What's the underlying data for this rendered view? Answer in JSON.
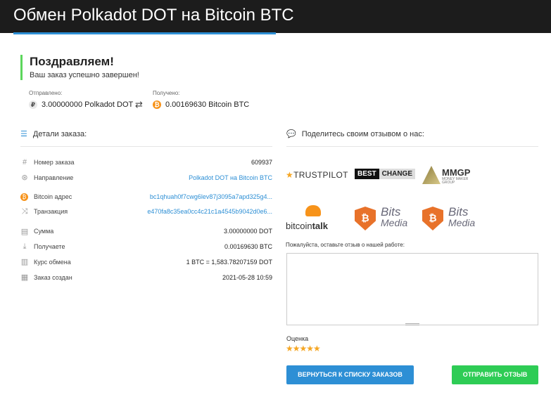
{
  "header": {
    "title": "Обмен Polkadot DOT на Bitcoin BTC"
  },
  "success": {
    "heading": "Поздравляем!",
    "message": "Ваш заказ успешно завершен!"
  },
  "transfer": {
    "sent_label": "Отправлено:",
    "sent_value": "3.00000000 Polkadot DOT",
    "received_label": "Получено:",
    "received_value": "0.00169630 Bitcoin BTC"
  },
  "details": {
    "title": "Детали заказа:",
    "rows": [
      {
        "label": "Номер заказа",
        "value": "609937",
        "icon": "hash-icon"
      },
      {
        "label": "Направление",
        "value": "Polkadot DOT на Bitcoin BTC",
        "icon": "direction-icon"
      },
      {
        "label": "Bitcoin адрес",
        "value": "bc1qhuah0f7cwg6lev87j3095a7apd325g4...",
        "icon": "bitcoin-icon"
      },
      {
        "label": "Транзакция",
        "value": "e470fa8c35ea0cc4c21c1a4545b9042d0e6...",
        "icon": "shuffle-icon"
      },
      {
        "label": "Сумма",
        "value": "3.00000000 DOT",
        "icon": "money-icon"
      },
      {
        "label": "Получаете",
        "value": "0.00169630 BTC",
        "icon": "download-icon"
      },
      {
        "label": "Курс обмена",
        "value": "1 BTC = 1,583.78207159 DOT",
        "icon": "chart-icon"
      },
      {
        "label": "Заказ создан",
        "value": "2021-05-28 10:59",
        "icon": "calendar-icon"
      }
    ]
  },
  "share": {
    "title": "Поделитесь своим отзывом о нас:",
    "logos": {
      "trustpilot": "TRUSTPILOT",
      "bestchange_1": "BEST",
      "bestchange_2": "CHANGE",
      "mmgp": "MMGP",
      "mmgp_sub": "MONEY MAKER GROUP",
      "bitcointalk_1": "bitcoin",
      "bitcointalk_2": "talk",
      "bitsmedia_1": "Bits",
      "bitsmedia_2": "Media"
    }
  },
  "feedback": {
    "label": "Пожалуйста, оставьте отзыв о нашей работе:",
    "value": "",
    "rating_label": "Оценка",
    "rating": 5,
    "stars": "★★★★★"
  },
  "buttons": {
    "back": "ВЕРНУТЬСЯ К СПИСКУ ЗАКАЗОВ",
    "send": "ОТПРАВИТЬ ОТЗЫВ"
  },
  "colors": {
    "accent": "#2d8fd5",
    "success": "#2ecc55",
    "bitcoin": "#f7931a",
    "star": "#f5a623"
  }
}
